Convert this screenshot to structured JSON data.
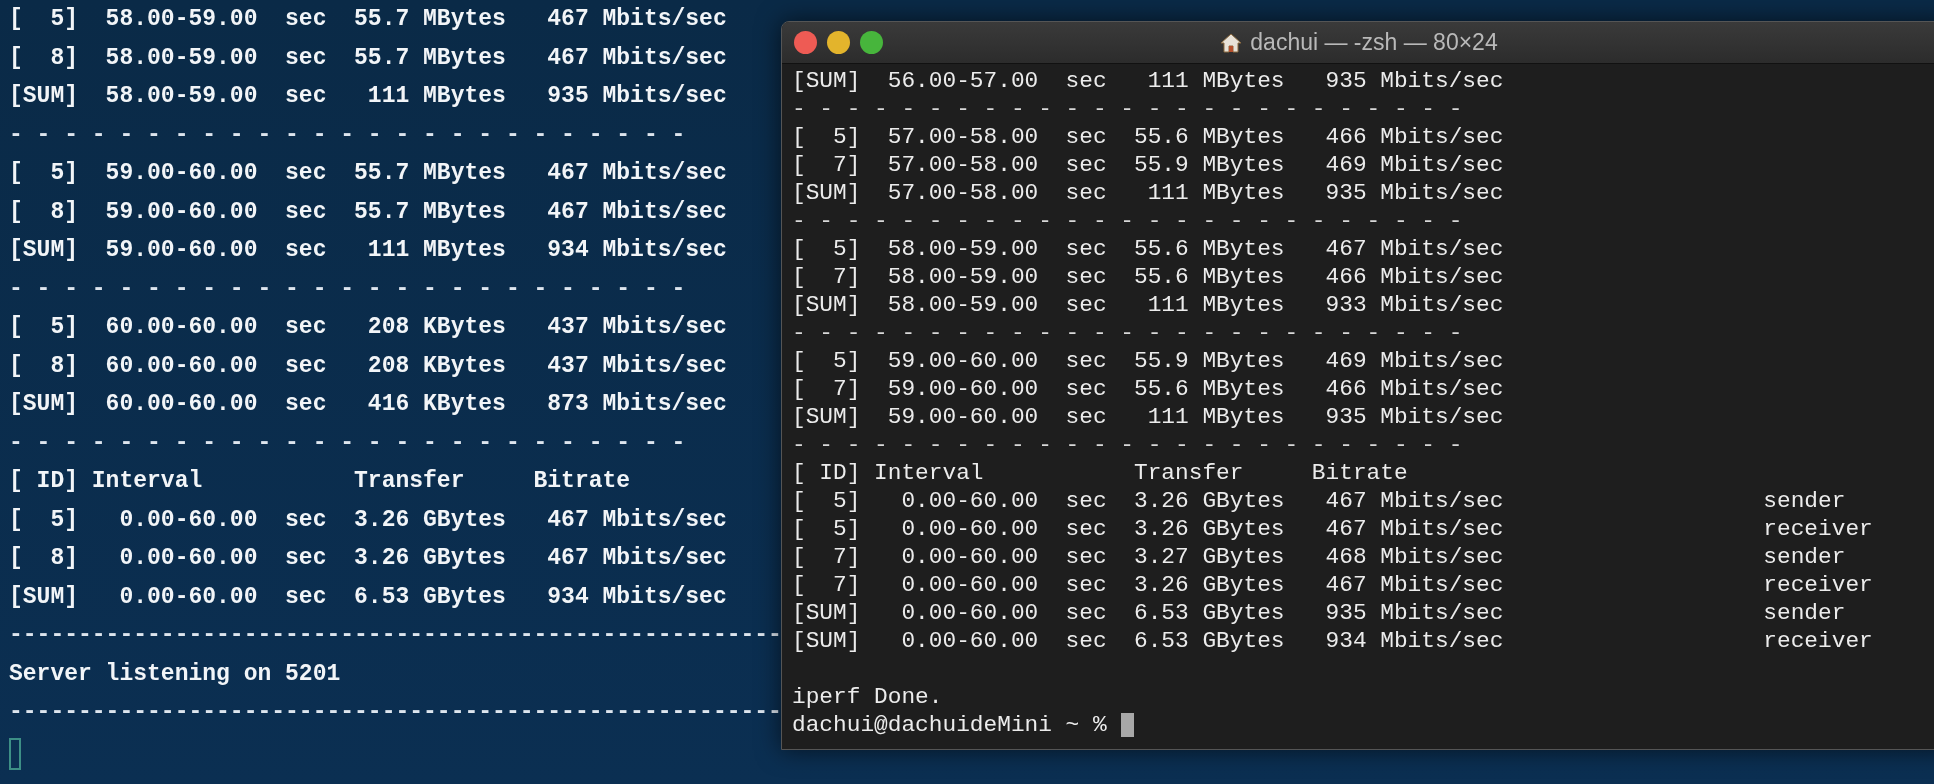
{
  "background_terminal": {
    "lines": [
      {
        "kind": "output",
        "text": "[  5]  58.00-59.00  sec  55.7 MBytes   467 Mbits/sec"
      },
      {
        "kind": "output",
        "text": "[  8]  58.00-59.00  sec  55.7 MBytes   467 Mbits/sec"
      },
      {
        "kind": "output",
        "text": "[SUM]  58.00-59.00  sec   111 MBytes   935 Mbits/sec"
      },
      {
        "kind": "separator",
        "text": "- - - - - - - - - - - - - - - - - - - - - - - - -"
      },
      {
        "kind": "output",
        "text": "[  5]  59.00-60.00  sec  55.7 MBytes   467 Mbits/sec"
      },
      {
        "kind": "output",
        "text": "[  8]  59.00-60.00  sec  55.7 MBytes   467 Mbits/sec"
      },
      {
        "kind": "output",
        "text": "[SUM]  59.00-60.00  sec   111 MBytes   934 Mbits/sec"
      },
      {
        "kind": "separator",
        "text": "- - - - - - - - - - - - - - - - - - - - - - - - -"
      },
      {
        "kind": "output",
        "text": "[  5]  60.00-60.00  sec   208 KBytes   437 Mbits/sec"
      },
      {
        "kind": "output",
        "text": "[  8]  60.00-60.00  sec   208 KBytes   437 Mbits/sec"
      },
      {
        "kind": "output",
        "text": "[SUM]  60.00-60.00  sec   416 KBytes   873 Mbits/sec"
      },
      {
        "kind": "separator",
        "text": "- - - - - - - - - - - - - - - - - - - - - - - - -"
      },
      {
        "kind": "output",
        "text": "[ ID] Interval           Transfer     Bitrate"
      },
      {
        "kind": "output",
        "text": "[  5]   0.00-60.00  sec  3.26 GBytes   467 Mbits/sec"
      },
      {
        "kind": "output",
        "text": "[  8]   0.00-60.00  sec  3.26 GBytes   467 Mbits/sec"
      },
      {
        "kind": "output",
        "text": "[SUM]   0.00-60.00  sec  6.53 GBytes   934 Mbits/sec"
      },
      {
        "kind": "separator",
        "text": "--------------------------------------------------------"
      },
      {
        "kind": "output",
        "text": "Server listening on 5201"
      },
      {
        "kind": "separator",
        "text": "--------------------------------------------------------"
      }
    ]
  },
  "window": {
    "title": "dachui — -zsh — 80×24",
    "lines": [
      {
        "kind": "output",
        "text": "[SUM]  56.00-57.00  sec   111 MBytes   935 Mbits/sec"
      },
      {
        "kind": "separator",
        "text": "- - - - - - - - - - - - - - - - - - - - - - - - -"
      },
      {
        "kind": "output",
        "text": "[  5]  57.00-58.00  sec  55.6 MBytes   466 Mbits/sec"
      },
      {
        "kind": "output",
        "text": "[  7]  57.00-58.00  sec  55.9 MBytes   469 Mbits/sec"
      },
      {
        "kind": "output",
        "text": "[SUM]  57.00-58.00  sec   111 MBytes   935 Mbits/sec"
      },
      {
        "kind": "separator",
        "text": "- - - - - - - - - - - - - - - - - - - - - - - - -"
      },
      {
        "kind": "output",
        "text": "[  5]  58.00-59.00  sec  55.6 MBytes   467 Mbits/sec"
      },
      {
        "kind": "output",
        "text": "[  7]  58.00-59.00  sec  55.6 MBytes   466 Mbits/sec"
      },
      {
        "kind": "output",
        "text": "[SUM]  58.00-59.00  sec   111 MBytes   933 Mbits/sec"
      },
      {
        "kind": "separator",
        "text": "- - - - - - - - - - - - - - - - - - - - - - - - -"
      },
      {
        "kind": "output",
        "text": "[  5]  59.00-60.00  sec  55.9 MBytes   469 Mbits/sec"
      },
      {
        "kind": "output",
        "text": "[  7]  59.00-60.00  sec  55.6 MBytes   466 Mbits/sec"
      },
      {
        "kind": "output",
        "text": "[SUM]  59.00-60.00  sec   111 MBytes   935 Mbits/sec"
      },
      {
        "kind": "separator",
        "text": "- - - - - - - - - - - - - - - - - - - - - - - - -"
      },
      {
        "kind": "output",
        "text": "[ ID] Interval           Transfer     Bitrate"
      },
      {
        "kind": "output",
        "text": "[  5]   0.00-60.00  sec  3.26 GBytes   467 Mbits/sec",
        "role": "sender"
      },
      {
        "kind": "output",
        "text": "[  5]   0.00-60.00  sec  3.26 GBytes   467 Mbits/sec",
        "role": "receiver"
      },
      {
        "kind": "output",
        "text": "[  7]   0.00-60.00  sec  3.27 GBytes   468 Mbits/sec",
        "role": "sender"
      },
      {
        "kind": "output",
        "text": "[  7]   0.00-60.00  sec  3.26 GBytes   467 Mbits/sec",
        "role": "receiver"
      },
      {
        "kind": "output",
        "text": "[SUM]   0.00-60.00  sec  6.53 GBytes   935 Mbits/sec",
        "role": "sender"
      },
      {
        "kind": "output",
        "text": "[SUM]   0.00-60.00  sec  6.53 GBytes   934 Mbits/sec",
        "role": "receiver"
      },
      {
        "kind": "blank"
      },
      {
        "kind": "output",
        "text": "iperf Done."
      }
    ],
    "prompt": "dachui@dachuideMini ~ %"
  }
}
